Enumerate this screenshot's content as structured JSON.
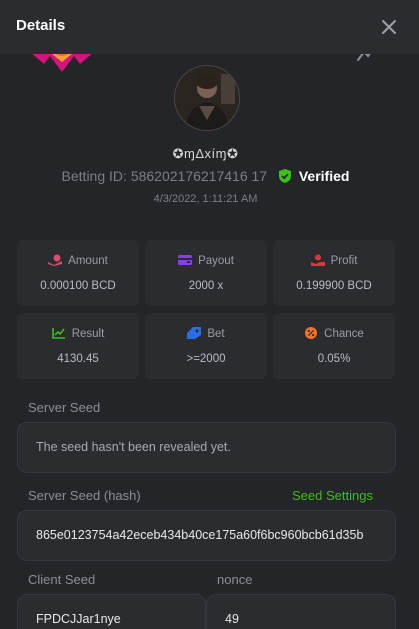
{
  "header": {
    "title": "Details"
  },
  "user": {
    "name": "✪ɱΔxíɱ✪"
  },
  "bet": {
    "id_label": "Betting ID:",
    "id_value": "586202176217416 17",
    "verified": "Verified",
    "date": "4/3/2022, 1:11:21 AM"
  },
  "cards": [
    {
      "label": "Amount",
      "value": "0.000100 BCD",
      "icon": "coin-hand-icon",
      "color": "#e24c6b"
    },
    {
      "label": "Payout",
      "value": "2000 x",
      "icon": "wallet-icon",
      "color": "#8a3df0"
    },
    {
      "label": "Profit",
      "value": "0.199900 BCD",
      "icon": "profit-hand-icon",
      "color": "#e0343f"
    },
    {
      "label": "Result",
      "value": "4130.45",
      "icon": "chart-check-icon",
      "color": "#3bc117"
    },
    {
      "label": "Bet",
      "value": ">=2000",
      "icon": "tag-icon",
      "color": "#2a6de8"
    },
    {
      "label": "Chance",
      "value": "0.05%",
      "icon": "percent-icon",
      "color": "#f0742a"
    }
  ],
  "server_seed": {
    "label": "Server Seed",
    "value": "The seed hasn't been revealed yet."
  },
  "server_seed_hash": {
    "label": "Server Seed (hash)",
    "settings_link": "Seed Settings",
    "value": "865e0123754a42eceb434b40ce175a60f6bc960bcb61d35b"
  },
  "client_seed": {
    "label": "Client Seed",
    "value": "FPDCJJar1nye"
  },
  "nonce": {
    "label": "nonce",
    "value": "49"
  }
}
